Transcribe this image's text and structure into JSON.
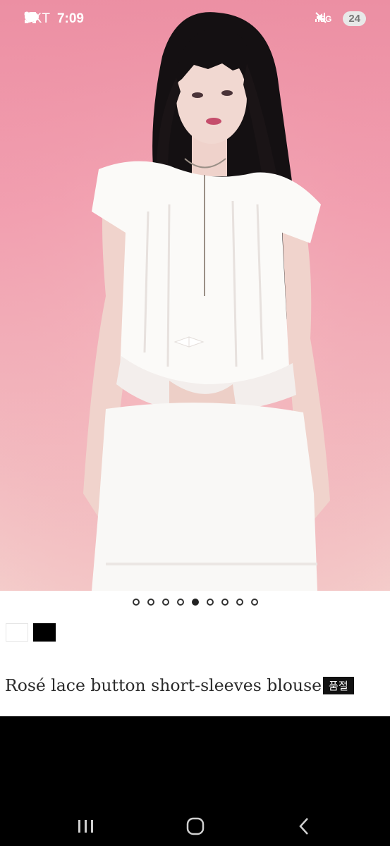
{
  "status_bar": {
    "carrier": "SKT",
    "time": "7:09",
    "battery": "24",
    "network": "5G",
    "left_icons": [
      "notification-icon",
      "screenshot-icon",
      "kakaotalk-icon",
      "dot-icon"
    ],
    "right_icons": [
      "mute-icon",
      "5g-icon",
      "signal-icon",
      "battery-icon"
    ]
  },
  "gallery": {
    "image_count": 9,
    "active_index": 4
  },
  "product": {
    "colors": [
      "#ffffff",
      "#000000"
    ],
    "title": "Rosé lace button short-sleeves blouse",
    "badge": "품절"
  },
  "nav": {
    "icons": [
      "recent-apps-icon",
      "home-icon",
      "back-icon"
    ]
  },
  "colors": {
    "photo_bg": "#f29fb0",
    "info_bg": "#ffffff",
    "badge_bg": "#111111"
  }
}
